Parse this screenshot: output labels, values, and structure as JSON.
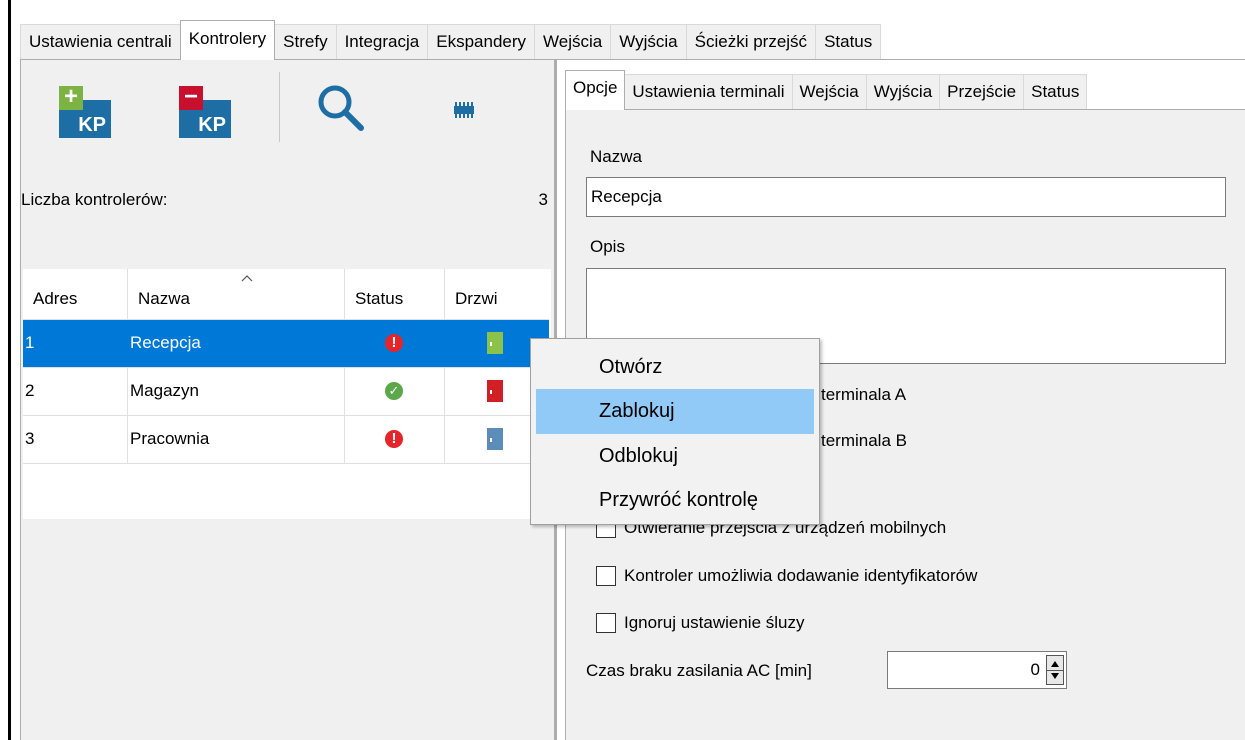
{
  "top_tabs": [
    "Ustawienia centrali",
    "Kontrolery",
    "Strefy",
    "Integracja",
    "Ekspandery",
    "Wejścia",
    "Wyjścia",
    "Ścieżki przejść",
    "Status"
  ],
  "top_tab_active": "Kontrolery",
  "toolbar": {
    "add_label": "KP",
    "remove_label": "KP",
    "add_icon": "add-controller-icon",
    "remove_icon": "remove-controller-icon",
    "search_icon": "search-icon",
    "device_icon": "module-icon"
  },
  "controllers": {
    "count_label": "Liczba kontrolerów:",
    "count_value": "3",
    "columns": [
      "Adres",
      "Nazwa",
      "Status",
      "Drzwi"
    ],
    "rows": [
      {
        "address": "1",
        "name": "Recepcja",
        "status": "error",
        "door": "open"
      },
      {
        "address": "2",
        "name": "Magazyn",
        "status": "ok",
        "door": "locked"
      },
      {
        "address": "3",
        "name": "Pracownia",
        "status": "error",
        "door": "closed"
      }
    ],
    "selected_row": "1"
  },
  "detail_tabs": [
    "Opcje",
    "Ustawienia terminali",
    "Wejścia",
    "Wyjścia",
    "Przejście",
    "Status"
  ],
  "detail_tab_active": "Opcje",
  "form": {
    "name_label": "Nazwa",
    "name_value": "Recepcja",
    "desc_label": "Opis",
    "desc_value": "",
    "terminal_a_fragment": "terminala A",
    "terminal_b_fragment": "terminala B",
    "cb_mobile": "Otwieranie przejścia z urządzeń mobilnych",
    "cb_add_ids": "Kontroler umożliwia dodawanie identyfikatorów",
    "cb_sluice": "Ignoruj ustawienie śluzy",
    "ac_label": "Czas braku zasilania AC [min]",
    "ac_value": "0"
  },
  "context_menu": {
    "items": [
      "Otwórz",
      "Zablokuj",
      "Odblokuj",
      "Przywróć kontrolę"
    ],
    "hovered": "Zablokuj"
  },
  "colors": {
    "selection": "#0078d7",
    "menu_hover": "#91c9f7",
    "door_open": "#8bc34a",
    "door_locked": "#d01f25",
    "door_closed": "#5b8db8",
    "status_error": "#e5252a",
    "status_ok": "#5ba84a"
  }
}
